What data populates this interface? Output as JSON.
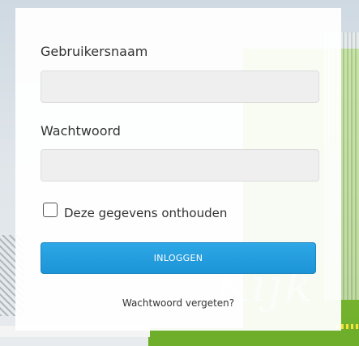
{
  "login_form": {
    "username_label": "Gebruikersnaam",
    "username_value": "",
    "password_label": "Wachtwoord",
    "password_value": "",
    "remember_label": "Deze gegevens onthouden",
    "remember_checked": false,
    "login_button": "INLOGGEN",
    "forgot_link": "Wachtwoord vergeten?"
  },
  "theme": {
    "button_color": "#1c94d6",
    "background_green": "#6fae2a"
  }
}
